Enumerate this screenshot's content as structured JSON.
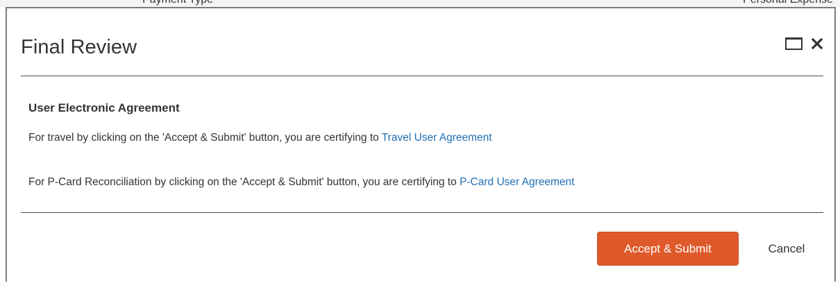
{
  "background": {
    "left_text": "Payment Type",
    "right_text": "Personal Expense"
  },
  "dialog": {
    "title": "Final Review",
    "controls": {
      "maximize_icon": "maximize-icon",
      "close_icon": "close-icon",
      "close_glyph": "×"
    }
  },
  "agreement": {
    "heading": "User Electronic Agreement",
    "lines": [
      {
        "text": "For travel by clicking on the 'Accept & Submit' button, you are certifying to ",
        "link": "Travel User Agreement"
      },
      {
        "text": "For P-Card Reconciliation by clicking on the 'Accept & Submit' button, you are certifying to ",
        "link": "P-Card User Agreement"
      }
    ]
  },
  "footer": {
    "accept_label": "Accept & Submit",
    "cancel_label": "Cancel"
  },
  "colors": {
    "accent": "#de5a2b",
    "link": "#1f6fb5",
    "text": "#333333"
  }
}
